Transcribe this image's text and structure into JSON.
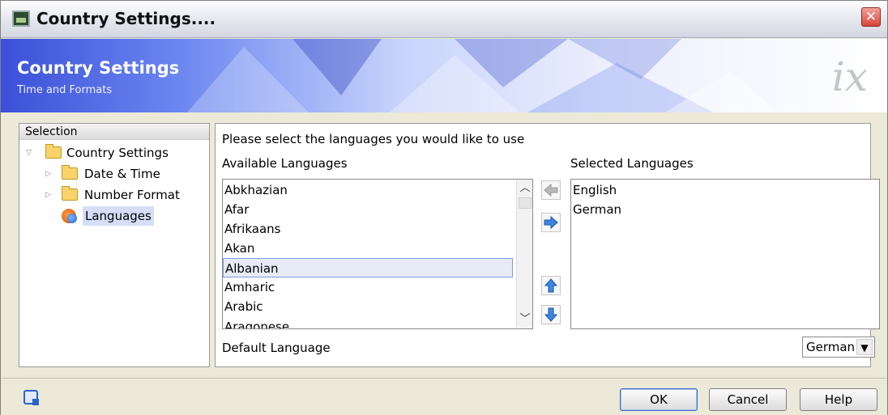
{
  "window": {
    "title": "Country Settings...."
  },
  "banner": {
    "title": "Country Settings",
    "subtitle": "Time and Formats",
    "logo": "ix"
  },
  "tree": {
    "header": "Selection",
    "items": [
      {
        "label": "Country Settings",
        "icon": "folder-open-icon"
      },
      {
        "label": "Date & Time",
        "icon": "folder-icon"
      },
      {
        "label": "Number Format",
        "icon": "folder-icon"
      },
      {
        "label": "Languages",
        "icon": "languages-icon"
      }
    ]
  },
  "main": {
    "prompt": "Please select the languages you would like to use",
    "available_label": "Available Languages",
    "selected_label": "Selected Languages",
    "available": [
      "Abkhazian",
      "Afar",
      "Afrikaans",
      "Akan",
      "Albanian",
      "Amharic",
      "Arabic",
      "Aragonese"
    ],
    "selected": [
      "English",
      "German"
    ],
    "default_language_label": "Default Language",
    "default_language_value": "German"
  },
  "footer": {
    "ok": "OK",
    "cancel": "Cancel",
    "help": "Help"
  },
  "colors": {
    "accent": "#3b50d8",
    "selection": "#e7ebf8"
  }
}
